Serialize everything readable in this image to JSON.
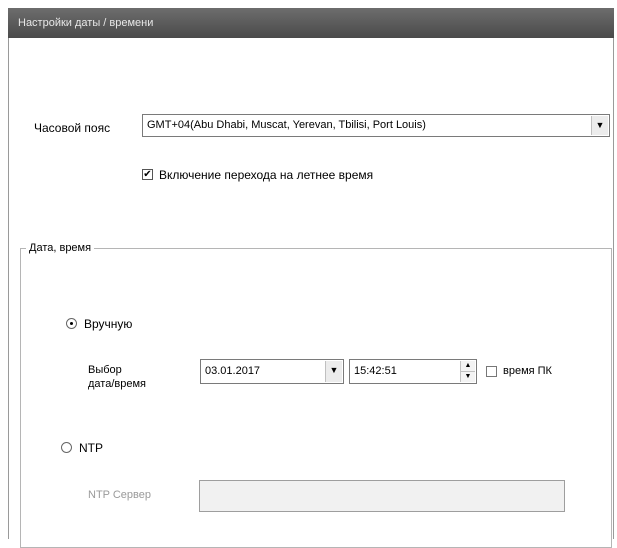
{
  "title": "Настройки даты / времени",
  "timezone": {
    "label": "Часовой пояс",
    "value": "GMT+04(Abu Dhabi, Muscat, Yerevan, Tbilisi, Port Louis)"
  },
  "dst": {
    "label": "Включение перехода на летнее время",
    "checked": true
  },
  "group": {
    "title": "Дата, время",
    "manual": {
      "label": "Вручную",
      "selected": true
    },
    "datetime_label_line1": "Выбор",
    "datetime_label_line2": "дата/время",
    "date": "03.01.2017",
    "time": "15:42:51",
    "pc_time": {
      "label": "время ПК",
      "checked": false
    },
    "ntp": {
      "label": "NTP",
      "selected": false
    },
    "ntp_server": {
      "label": "NTP Сервер",
      "value": ""
    }
  },
  "icons": {
    "dropdown": "chevron-down-icon",
    "spin": "spin-updown-icon",
    "check": "checkmark-icon"
  }
}
